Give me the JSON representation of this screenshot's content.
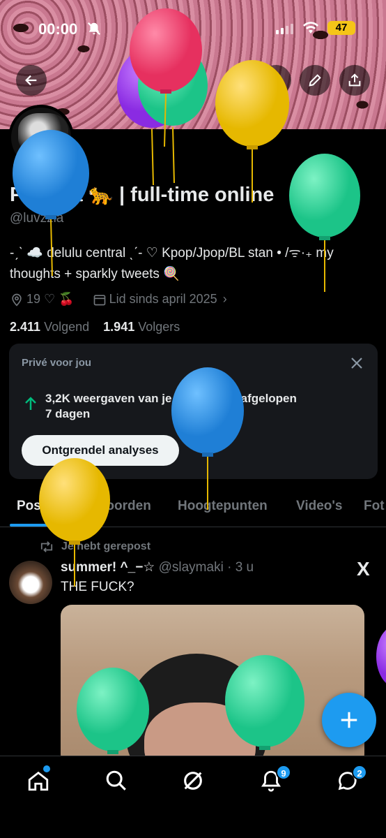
{
  "status_bar": {
    "time": "00:00",
    "battery": "47"
  },
  "header": {
    "back_icon": "back-arrow-icon",
    "icons": [
      "search-icon",
      "edit-icon",
      "share-icon"
    ]
  },
  "profile": {
    "name": "Patricia 🐆 | full-time online",
    "handle": "@luvzzia",
    "bio_line1": "-ˏˋ ☁️ delulu central ˎˊ- ♡ Kpop/Jpop/BL stan • /ᯤ·₊ my",
    "bio_line2": "thoughts + sparkly tweets 🍭",
    "location": "19 ♡ 🍒",
    "joined": "Lid sinds april 2025",
    "following_count": "2.411",
    "following_label": "Volgend",
    "followers_count": "1.941",
    "followers_label": "Volgers"
  },
  "private_card": {
    "title": "Privé voor jou",
    "stat_line1": "3,2K weergaven van je posts in de afgelopen",
    "stat_line2": "7 dagen",
    "button": "Ontgrendel analyses"
  },
  "tabs": [
    {
      "label": "Posts",
      "active": true
    },
    {
      "label": "Antwoorden"
    },
    {
      "label": "Hoogtepunten"
    },
    {
      "label": "Video's"
    },
    {
      "label": "Fot"
    }
  ],
  "post": {
    "repost_label": "Je hebt gerepost",
    "author_name": "summer! ^_−☆",
    "author_handle": "@slaymaki",
    "separator": "·",
    "time": "3 u",
    "text": "THE FUCK?",
    "source_logo": "X"
  },
  "bottom_nav": {
    "items": [
      "home-icon",
      "search-icon",
      "grok-icon",
      "notifications-icon",
      "messages-icon"
    ],
    "notifications_badge": "9",
    "messages_badge": "2"
  },
  "colors": {
    "accent": "#1d9bf0",
    "background": "#000000",
    "muted": "#71767b"
  }
}
